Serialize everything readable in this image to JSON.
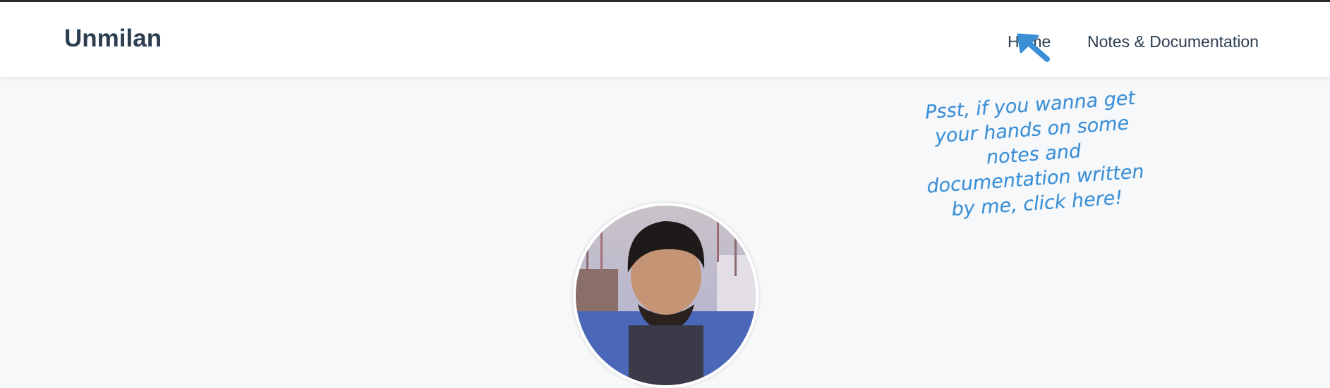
{
  "header": {
    "brand": "Unmilan",
    "nav": [
      {
        "label": "Home"
      },
      {
        "label": "Notes & Documentation"
      }
    ]
  },
  "hint": {
    "text": "Psst, if you wanna get your hands on some notes and documentation written by me, click here!"
  },
  "icons": {
    "arrow": "arrow-up-left-icon"
  },
  "colors": {
    "brand": "#2c3e50",
    "accent": "#3a8fd6",
    "background": "#f7f8fa"
  }
}
